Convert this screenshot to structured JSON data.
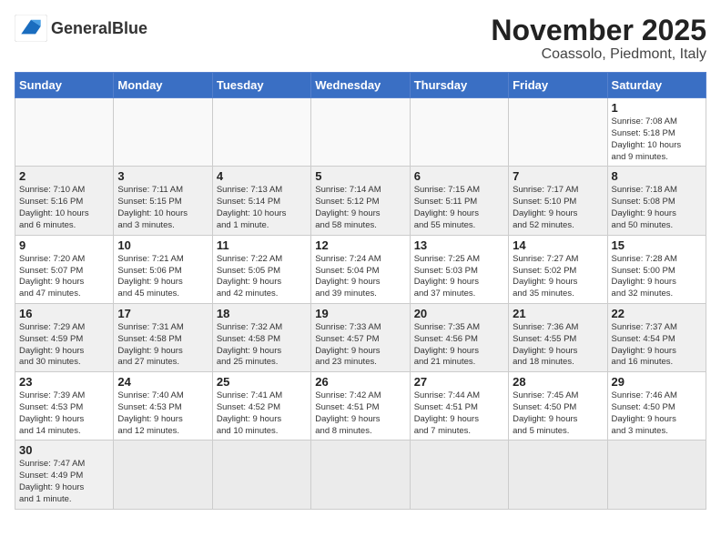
{
  "header": {
    "logo_text_regular": "General",
    "logo_text_bold": "Blue",
    "month_title": "November 2025",
    "location": "Coassolo, Piedmont, Italy"
  },
  "weekdays": [
    "Sunday",
    "Monday",
    "Tuesday",
    "Wednesday",
    "Thursday",
    "Friday",
    "Saturday"
  ],
  "weeks": [
    [
      {
        "day": "",
        "info": ""
      },
      {
        "day": "",
        "info": ""
      },
      {
        "day": "",
        "info": ""
      },
      {
        "day": "",
        "info": ""
      },
      {
        "day": "",
        "info": ""
      },
      {
        "day": "",
        "info": ""
      },
      {
        "day": "1",
        "info": "Sunrise: 7:08 AM\nSunset: 5:18 PM\nDaylight: 10 hours\nand 9 minutes."
      }
    ],
    [
      {
        "day": "2",
        "info": "Sunrise: 7:10 AM\nSunset: 5:16 PM\nDaylight: 10 hours\nand 6 minutes."
      },
      {
        "day": "3",
        "info": "Sunrise: 7:11 AM\nSunset: 5:15 PM\nDaylight: 10 hours\nand 3 minutes."
      },
      {
        "day": "4",
        "info": "Sunrise: 7:13 AM\nSunset: 5:14 PM\nDaylight: 10 hours\nand 1 minute."
      },
      {
        "day": "5",
        "info": "Sunrise: 7:14 AM\nSunset: 5:12 PM\nDaylight: 9 hours\nand 58 minutes."
      },
      {
        "day": "6",
        "info": "Sunrise: 7:15 AM\nSunset: 5:11 PM\nDaylight: 9 hours\nand 55 minutes."
      },
      {
        "day": "7",
        "info": "Sunrise: 7:17 AM\nSunset: 5:10 PM\nDaylight: 9 hours\nand 52 minutes."
      },
      {
        "day": "8",
        "info": "Sunrise: 7:18 AM\nSunset: 5:08 PM\nDaylight: 9 hours\nand 50 minutes."
      }
    ],
    [
      {
        "day": "9",
        "info": "Sunrise: 7:20 AM\nSunset: 5:07 PM\nDaylight: 9 hours\nand 47 minutes."
      },
      {
        "day": "10",
        "info": "Sunrise: 7:21 AM\nSunset: 5:06 PM\nDaylight: 9 hours\nand 45 minutes."
      },
      {
        "day": "11",
        "info": "Sunrise: 7:22 AM\nSunset: 5:05 PM\nDaylight: 9 hours\nand 42 minutes."
      },
      {
        "day": "12",
        "info": "Sunrise: 7:24 AM\nSunset: 5:04 PM\nDaylight: 9 hours\nand 39 minutes."
      },
      {
        "day": "13",
        "info": "Sunrise: 7:25 AM\nSunset: 5:03 PM\nDaylight: 9 hours\nand 37 minutes."
      },
      {
        "day": "14",
        "info": "Sunrise: 7:27 AM\nSunset: 5:02 PM\nDaylight: 9 hours\nand 35 minutes."
      },
      {
        "day": "15",
        "info": "Sunrise: 7:28 AM\nSunset: 5:00 PM\nDaylight: 9 hours\nand 32 minutes."
      }
    ],
    [
      {
        "day": "16",
        "info": "Sunrise: 7:29 AM\nSunset: 4:59 PM\nDaylight: 9 hours\nand 30 minutes."
      },
      {
        "day": "17",
        "info": "Sunrise: 7:31 AM\nSunset: 4:58 PM\nDaylight: 9 hours\nand 27 minutes."
      },
      {
        "day": "18",
        "info": "Sunrise: 7:32 AM\nSunset: 4:58 PM\nDaylight: 9 hours\nand 25 minutes."
      },
      {
        "day": "19",
        "info": "Sunrise: 7:33 AM\nSunset: 4:57 PM\nDaylight: 9 hours\nand 23 minutes."
      },
      {
        "day": "20",
        "info": "Sunrise: 7:35 AM\nSunset: 4:56 PM\nDaylight: 9 hours\nand 21 minutes."
      },
      {
        "day": "21",
        "info": "Sunrise: 7:36 AM\nSunset: 4:55 PM\nDaylight: 9 hours\nand 18 minutes."
      },
      {
        "day": "22",
        "info": "Sunrise: 7:37 AM\nSunset: 4:54 PM\nDaylight: 9 hours\nand 16 minutes."
      }
    ],
    [
      {
        "day": "23",
        "info": "Sunrise: 7:39 AM\nSunset: 4:53 PM\nDaylight: 9 hours\nand 14 minutes."
      },
      {
        "day": "24",
        "info": "Sunrise: 7:40 AM\nSunset: 4:53 PM\nDaylight: 9 hours\nand 12 minutes."
      },
      {
        "day": "25",
        "info": "Sunrise: 7:41 AM\nSunset: 4:52 PM\nDaylight: 9 hours\nand 10 minutes."
      },
      {
        "day": "26",
        "info": "Sunrise: 7:42 AM\nSunset: 4:51 PM\nDaylight: 9 hours\nand 8 minutes."
      },
      {
        "day": "27",
        "info": "Sunrise: 7:44 AM\nSunset: 4:51 PM\nDaylight: 9 hours\nand 7 minutes."
      },
      {
        "day": "28",
        "info": "Sunrise: 7:45 AM\nSunset: 4:50 PM\nDaylight: 9 hours\nand 5 minutes."
      },
      {
        "day": "29",
        "info": "Sunrise: 7:46 AM\nSunset: 4:50 PM\nDaylight: 9 hours\nand 3 minutes."
      }
    ],
    [
      {
        "day": "30",
        "info": "Sunrise: 7:47 AM\nSunset: 4:49 PM\nDaylight: 9 hours\nand 1 minute."
      },
      {
        "day": "",
        "info": ""
      },
      {
        "day": "",
        "info": ""
      },
      {
        "day": "",
        "info": ""
      },
      {
        "day": "",
        "info": ""
      },
      {
        "day": "",
        "info": ""
      },
      {
        "day": "",
        "info": ""
      }
    ]
  ]
}
